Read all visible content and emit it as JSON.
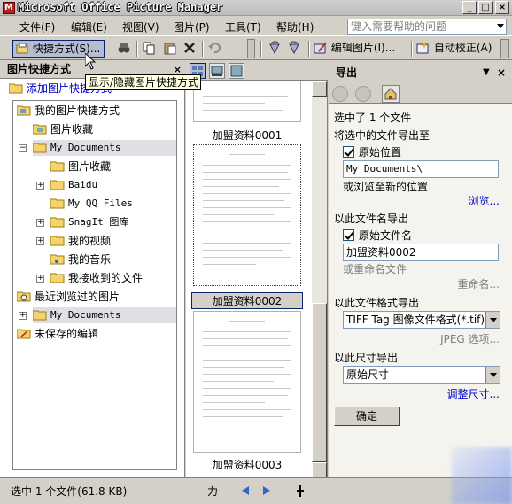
{
  "window": {
    "title": "Microsoft Office Picture Manager",
    "app_icon": "picture-manager-icon",
    "controls": [
      "_",
      "□",
      "×"
    ]
  },
  "menu": {
    "items": [
      "文件(F)",
      "编辑(E)",
      "视图(V)",
      "图片(P)",
      "工具(T)",
      "帮助(H)"
    ],
    "help_placeholder": "键入需要帮助的问题"
  },
  "toolbar": {
    "shortcuts_label": "快捷方式(S)...",
    "edit_picture_label": "编辑图片(I)...",
    "autocorrect_label": "自动校正(A)"
  },
  "tooltip": "显示/隐藏图片快捷方式",
  "left_pane": {
    "title": "图片快捷方式",
    "add_shortcut": "添加图片快捷方式",
    "tree": [
      {
        "label": "我的图片快捷方式"
      },
      {
        "label": "图片收藏"
      },
      {
        "label": "My Documents"
      },
      {
        "label": "图片收藏"
      },
      {
        "label": "Baidu"
      },
      {
        "label": "My QQ Files"
      },
      {
        "label": "SnagIt 图库"
      },
      {
        "label": "我的视频"
      },
      {
        "label": "我的音乐"
      },
      {
        "label": "我接收到的文件"
      },
      {
        "label": "最近浏览过的图片"
      },
      {
        "label": "My Documents"
      },
      {
        "label": "未保存的编辑"
      }
    ]
  },
  "thumbnails": [
    {
      "label": "加盟资料0001"
    },
    {
      "label": "加盟资料0002",
      "selected": true
    },
    {
      "label": "加盟资料0003"
    }
  ],
  "export_pane": {
    "title": "导出",
    "selected_count": "选中了 1 个文件",
    "export_to_heading": "将选中的文件导出至",
    "original_location_label": "原始位置",
    "original_location_checked": true,
    "location_value": "My Documents\\",
    "browse_new_location": "或浏览至新的位置",
    "browse_link": "浏览...",
    "filename_heading": "以此文件名导出",
    "original_filename_label": "原始文件名",
    "original_filename_checked": true,
    "filename_value": "加盟资料0002",
    "or_rename": "或重命名文件",
    "rename_link": "重命名...",
    "format_heading": "以此文件格式导出",
    "format_value": "TIFF Tag 图像文件格式(*.tif)",
    "jpeg_options": "JPEG 选项...",
    "size_heading": "以此尺寸导出",
    "size_value": "原始尺寸",
    "resize_link": "调整尺寸...",
    "ok_label": "确定"
  },
  "status": {
    "text": "选中 1 个文件(61.8 KB)",
    "zoom_glyph": "力"
  }
}
